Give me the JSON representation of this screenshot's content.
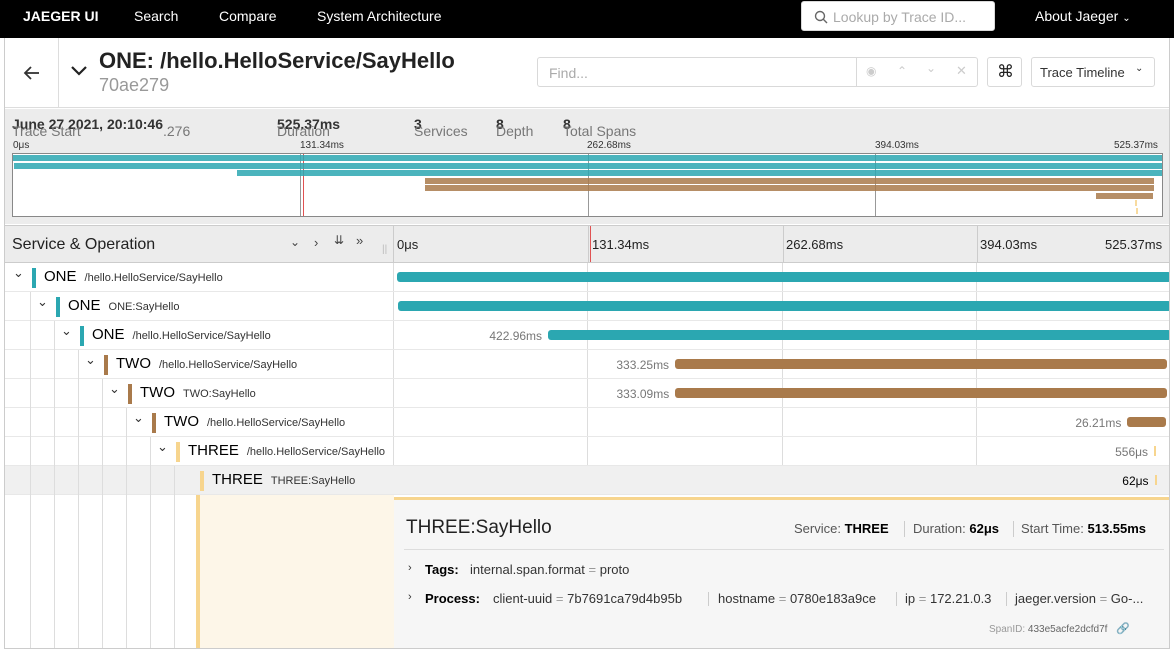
{
  "nav": {
    "brand": "JAEGER UI",
    "search": "Search",
    "compare": "Compare",
    "system_architecture": "System Architecture",
    "lookup_placeholder": "Lookup by Trace ID...",
    "about": "About Jaeger"
  },
  "trace": {
    "title": "ONE: /hello.HelloService/SayHello",
    "trace_id": "70ae279",
    "find_placeholder": "Find...",
    "view_mode": "Trace Timeline"
  },
  "summary": {
    "trace_start_label": "Trace Start",
    "trace_start_value": "June 27 2021, 20:10:46",
    "trace_start_ms": ".276",
    "duration_label": "Duration",
    "duration_value": "525.37ms",
    "services_label": "Services",
    "services_value": "3",
    "depth_label": "Depth",
    "depth_value": "8",
    "total_spans_label": "Total Spans",
    "total_spans_value": "8"
  },
  "minimap": {
    "ticks": [
      "0μs",
      "131.34ms",
      "262.68ms",
      "394.03ms",
      "525.37ms"
    ]
  },
  "timeline_header": {
    "service_operation": "Service & Operation",
    "ticks": [
      "0μs",
      "131.34ms",
      "262.68ms",
      "394.03ms",
      "525.37ms"
    ]
  },
  "colors": {
    "ONE": "#2ba7b1",
    "TWO": "#a97a4b",
    "THREE": "#f7d58e"
  },
  "spans": [
    {
      "service": "ONE",
      "operation": "/hello.HelloService/SayHello",
      "label": "",
      "depth": 0,
      "start_ms": 0,
      "duration_ms": 525.37
    },
    {
      "service": "ONE",
      "operation": "ONE:SayHello",
      "label": "",
      "depth": 1,
      "start_ms": 0.5,
      "duration_ms": 524.87
    },
    {
      "service": "ONE",
      "operation": "/hello.HelloService/SayHello",
      "label": "422.96ms",
      "depth": 2,
      "start_ms": 102.4,
      "duration_ms": 422.96
    },
    {
      "service": "TWO",
      "operation": "/hello.HelloService/SayHello",
      "label": "333.25ms",
      "depth": 3,
      "start_ms": 188.5,
      "duration_ms": 333.25
    },
    {
      "service": "TWO",
      "operation": "TWO:SayHello",
      "label": "333.09ms",
      "depth": 4,
      "start_ms": 188.6,
      "duration_ms": 333.09
    },
    {
      "service": "TWO",
      "operation": "/hello.HelloService/SayHello",
      "label": "26.21ms",
      "depth": 5,
      "start_ms": 495.1,
      "duration_ms": 26.21
    },
    {
      "service": "THREE",
      "operation": "/hello.HelloService/SayHello",
      "label": "556μs",
      "depth": 6,
      "start_ms": 513.2,
      "duration_ms": 0.556
    },
    {
      "service": "THREE",
      "operation": "THREE:SayHello",
      "label": "62μs",
      "depth": 7,
      "start_ms": 513.55,
      "duration_ms": 0.062
    }
  ],
  "detail": {
    "title": "THREE:SayHello",
    "service_label": "Service:",
    "service_value": "THREE",
    "duration_label": "Duration:",
    "duration_value": "62μs",
    "start_label": "Start Time:",
    "start_value": "513.55ms",
    "tags_label": "Tags:",
    "tags": [
      {
        "key": "internal.span.format",
        "value": "proto"
      }
    ],
    "process_label": "Process:",
    "process": [
      {
        "key": "client-uuid",
        "value": "7b7691ca79d4b95b"
      },
      {
        "key": "hostname",
        "value": "0780e183a9ce"
      },
      {
        "key": "ip",
        "value": "172.21.0.3"
      },
      {
        "key": "jaeger.version",
        "value": "Go-..."
      }
    ],
    "span_id_label": "SpanID:",
    "span_id_value": "433e5acfe2dcfd7f"
  }
}
